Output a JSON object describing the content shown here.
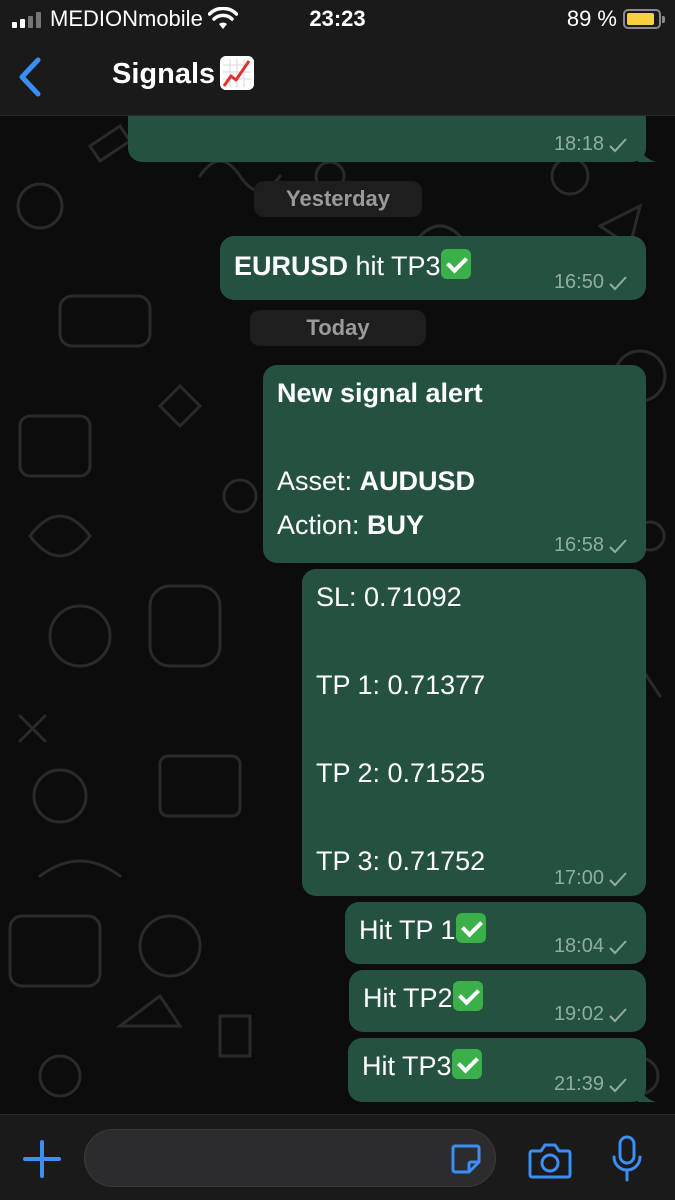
{
  "status_bar": {
    "carrier": "MEDIONmobile",
    "time": "23:23",
    "battery_percent": "89 %",
    "battery_level": 0.89,
    "battery_color": "#f7d23c"
  },
  "header": {
    "back_icon": "chevron-left-icon",
    "title": "Signals",
    "title_icon": "chart-increasing-emoji"
  },
  "chat": {
    "dates": {
      "yesterday": "Yesterday",
      "today": "Today"
    },
    "messages": [
      {
        "time": "18:18"
      },
      {
        "asset": "EURUSD",
        "text": " hit TP3",
        "time": "16:50"
      },
      {
        "heading": "New signal alert",
        "asset_label": "Asset: ",
        "asset_value": "AUDUSD",
        "action_label": "Action: ",
        "action_value": "BUY",
        "time": "16:58"
      },
      {
        "sl": "SL: 0.71092",
        "tp1": "TP 1: 0.71377",
        "tp2": "TP 2: 0.71525",
        "tp3": "TP 3: 0.71752",
        "time": "17:00"
      },
      {
        "text": "Hit TP 1",
        "time": "18:04"
      },
      {
        "text": "Hit TP2",
        "time": "19:02"
      },
      {
        "text": "Hit TP3",
        "time": "21:39"
      }
    ],
    "bubble_color": "#255240",
    "accent": "#3b8ef3"
  },
  "input_bar": {
    "placeholder": "",
    "icons": [
      "plus-icon",
      "sticker-icon",
      "camera-icon",
      "microphone-icon"
    ]
  }
}
